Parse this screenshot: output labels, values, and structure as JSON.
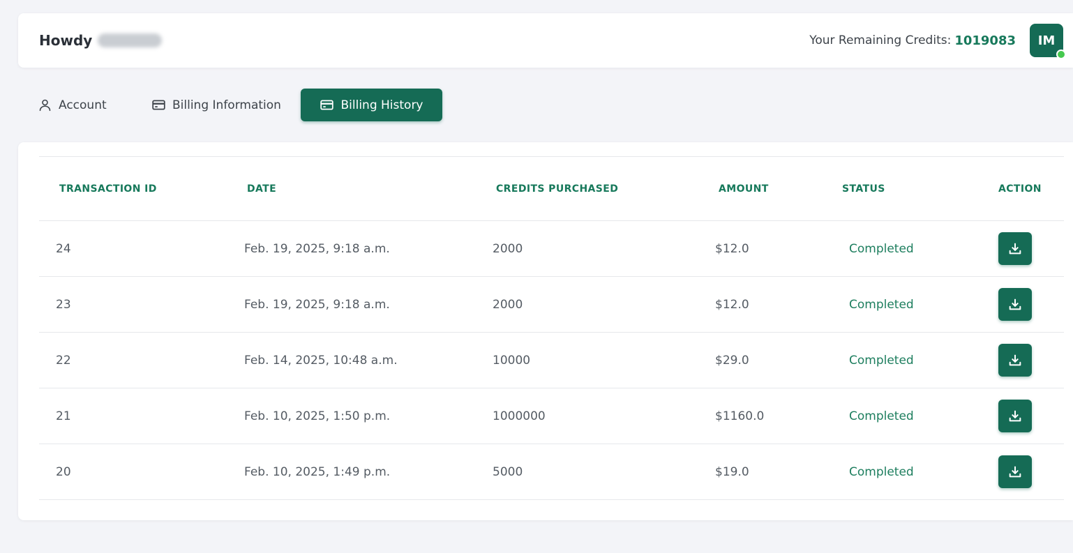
{
  "header": {
    "greeting": "Howdy",
    "credits_label": "Your Remaining Credits:",
    "credits_value": "1019083",
    "avatar_initials": "IM"
  },
  "tabs": [
    {
      "label": "Account",
      "icon": "user-icon",
      "active": false
    },
    {
      "label": "Billing Information",
      "icon": "credit-card-icon",
      "active": false
    },
    {
      "label": "Billing History",
      "icon": "credit-card-icon",
      "active": true
    }
  ],
  "table": {
    "columns": [
      "TRANSACTION ID",
      "DATE",
      "CREDITS PURCHASED",
      "AMOUNT",
      "STATUS",
      "ACTION"
    ],
    "rows": [
      {
        "id": "24",
        "date": "Feb. 19, 2025, 9:18 a.m.",
        "credits": "2000",
        "amount": "$12.0",
        "status": "Completed",
        "action_icon": "download-icon"
      },
      {
        "id": "23",
        "date": "Feb. 19, 2025, 9:18 a.m.",
        "credits": "2000",
        "amount": "$12.0",
        "status": "Completed",
        "action_icon": "download-icon"
      },
      {
        "id": "22",
        "date": "Feb. 14, 2025, 10:48 a.m.",
        "credits": "10000",
        "amount": "$29.0",
        "status": "Completed",
        "action_icon": "download-icon"
      },
      {
        "id": "21",
        "date": "Feb. 10, 2025, 1:50 p.m.",
        "credits": "1000000",
        "amount": "$1160.0",
        "status": "Completed",
        "action_icon": "download-icon"
      },
      {
        "id": "20",
        "date": "Feb. 10, 2025, 1:49 p.m.",
        "credits": "5000",
        "amount": "$19.0",
        "status": "Completed",
        "action_icon": "download-icon"
      }
    ]
  },
  "colors": {
    "brand": "#156b55",
    "accent_text": "#17795b",
    "online": "#46c94f",
    "background": "#f3f4f8"
  }
}
